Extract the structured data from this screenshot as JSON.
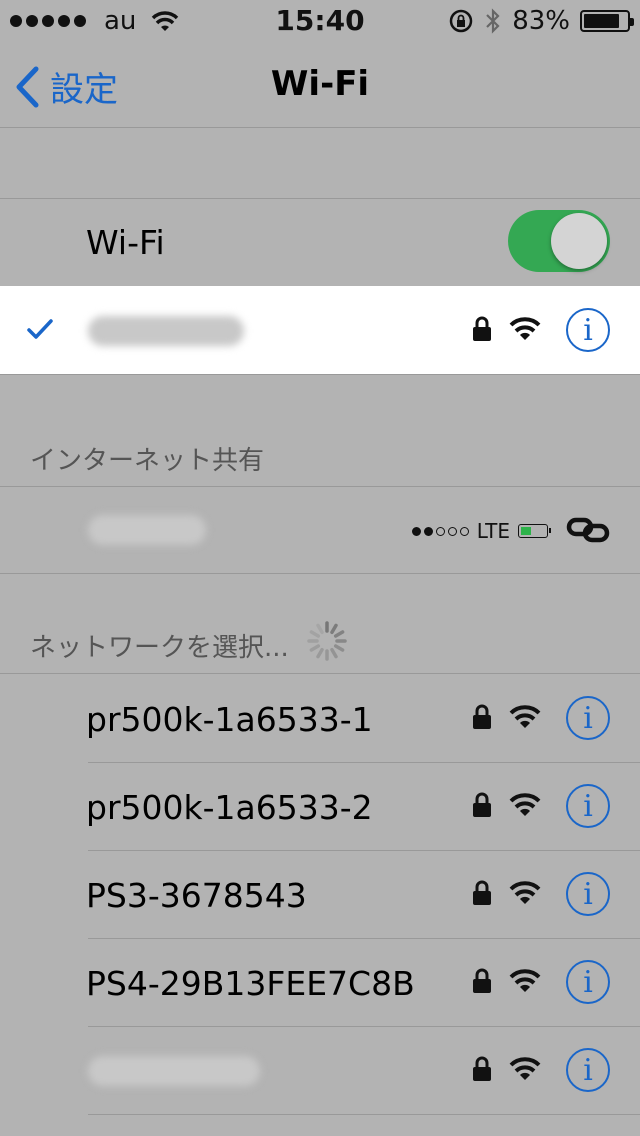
{
  "status_bar": {
    "carrier": "au",
    "time": "15:40",
    "battery_percent_label": "83%",
    "battery_level": 0.83
  },
  "nav": {
    "back_label": "設定",
    "title": "Wi-Fi"
  },
  "wifi_toggle": {
    "label": "Wi-Fi",
    "on": true
  },
  "sections": {
    "hotspot_header": "インターネット共有",
    "networks_header": "ネットワークを選択..."
  },
  "hotspot": {
    "network_type": "LTE"
  },
  "networks": [
    {
      "name": "pr500k-1a6533-1",
      "locked": true
    },
    {
      "name": "pr500k-1a6533-2",
      "locked": true
    },
    {
      "name": "PS3-3678543",
      "locked": true
    },
    {
      "name": "PS4-29B13FEE7C8B",
      "locked": true
    }
  ],
  "colors": {
    "accent": "#1a66c9",
    "toggle_on": "#34a853",
    "background": "#b3b3b3",
    "selected_row": "#ffffff"
  }
}
